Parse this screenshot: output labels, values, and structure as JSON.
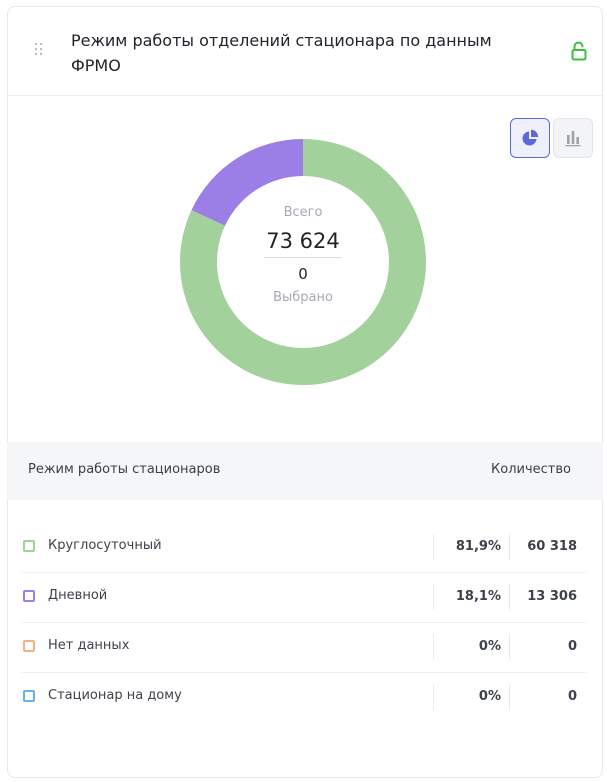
{
  "header": {
    "title": "Режим работы отделений стационара по данным ФРМО"
  },
  "icons": {
    "drag": "drag-handle-icon",
    "lock": "lock-open-icon",
    "pie": "pie-chart-icon",
    "bar": "bar-chart-icon"
  },
  "colors": {
    "accent": "#5b6ad8",
    "lock": "#3dbf3d"
  },
  "summary": {
    "total_label": "Всего",
    "total_value": "73 624",
    "selected_value": "0",
    "selected_label": "Выбрано"
  },
  "table": {
    "col_name": "Режим работы стационаров",
    "col_count": "Количество",
    "rows": [
      {
        "label": "Круглосуточный",
        "percent": "81,9%",
        "count": "60 318",
        "color": "#a3d19c"
      },
      {
        "label": "Дневной",
        "percent": "18,1%",
        "count": "13 306",
        "color": "#9b7fe6"
      },
      {
        "label": "Нет данных",
        "percent": "0%",
        "count": "0",
        "color": "#f2b283"
      },
      {
        "label": "Стационар на дому",
        "percent": "0%",
        "count": "0",
        "color": "#6fb2e2"
      }
    ]
  },
  "chart_data": {
    "type": "pie",
    "categories": [
      "Круглосуточный",
      "Дневной",
      "Нет данных",
      "Стационар на дому"
    ],
    "values": [
      60318,
      13306,
      0,
      0
    ],
    "colors": [
      "#a3d19c",
      "#9b7fe6",
      "#f2b283",
      "#6fb2e2"
    ],
    "donut": true
  }
}
